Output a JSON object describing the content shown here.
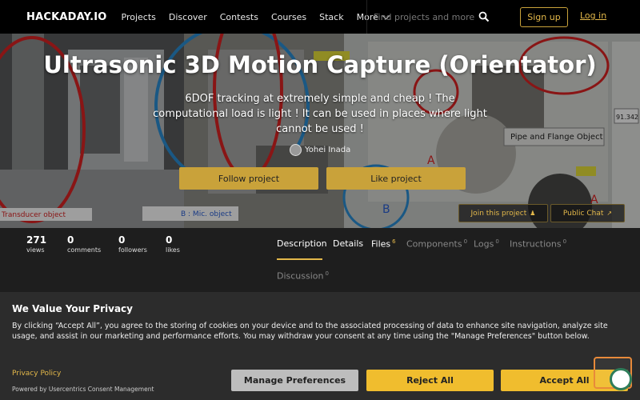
{
  "nav": {
    "logo": "HACKADAY.IO",
    "links": [
      "Projects",
      "Discover",
      "Contests",
      "Courses",
      "Stack"
    ],
    "more": "More",
    "search_placeholder": "Find projects and more",
    "signup": "Sign up",
    "login": "Log in"
  },
  "hero": {
    "title": "Ultrasonic 3D Motion Capture (Orientator)",
    "description": "6DOF tracking at extremely simple and cheap ! The computational load is light ! It can be used in places where light cannot be used !",
    "author": "Yohei Inada",
    "follow": "Follow project",
    "like": "Like project",
    "join": "Join this project",
    "chat": "Public Chat",
    "image_labels": {
      "transducer": "Transducer object",
      "mic": "B : Mic. object",
      "pipe": "Pipe and Flange Object",
      "letter_a1": "A",
      "letter_a2": "A",
      "letter_b": "B",
      "value_box": "91.342"
    }
  },
  "stats": [
    {
      "value": "271",
      "label": "views"
    },
    {
      "value": "0",
      "label": "comments"
    },
    {
      "value": "0",
      "label": "followers"
    },
    {
      "value": "0",
      "label": "likes"
    }
  ],
  "tabs": [
    {
      "label": "Description",
      "count": ""
    },
    {
      "label": "Details",
      "count": ""
    },
    {
      "label": "Files",
      "count": "6"
    },
    {
      "label": "Components",
      "count": "0"
    },
    {
      "label": "Logs",
      "count": "0"
    },
    {
      "label": "Instructions",
      "count": "0"
    },
    {
      "label": "Discussion",
      "count": "0"
    }
  ],
  "privacy": {
    "title": "We Value Your Privacy",
    "text": "By clicking “Accept All”, you agree to the storing of cookies on your device and to the associated processing of data to enhance site navigation, analyze site usage, and assist in our marketing and performance efforts. You may withdraw your consent at any time using the \"Manage Preferences\" button below.",
    "policy": "Privacy Policy",
    "powered": "Powered by Usercentrics Consent Management",
    "manage": "Manage Preferences",
    "reject": "Reject All",
    "accept": "Accept All"
  },
  "colors": {
    "accent": "#e3b84a",
    "button_gold": "#c9a23a",
    "consent_yellow": "#f0bd2e"
  }
}
